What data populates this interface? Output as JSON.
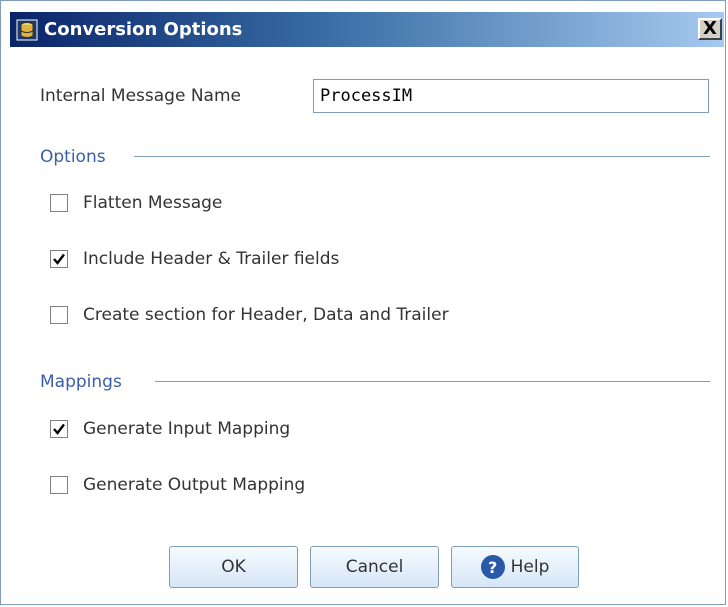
{
  "window": {
    "title": "Conversion Options",
    "close_label": "X"
  },
  "form": {
    "internal_message_label": "Internal Message Name",
    "internal_message_value": "ProcessIM"
  },
  "options": {
    "header": "Options",
    "items": [
      {
        "label": "Flatten Message",
        "checked": false
      },
      {
        "label": "Include Header & Trailer fields",
        "checked": true
      },
      {
        "label": "Create section for Header, Data and Trailer",
        "checked": false
      }
    ]
  },
  "mappings": {
    "header": "Mappings",
    "items": [
      {
        "label": "Generate Input Mapping",
        "checked": true
      },
      {
        "label": "Generate Output Mapping",
        "checked": false
      }
    ]
  },
  "buttons": {
    "ok": "OK",
    "cancel": "Cancel",
    "help": "Help"
  },
  "colors": {
    "accent": "#3a5ea8",
    "titlebar_start": "#0a246a",
    "border": "#7f9db9"
  },
  "icons": {
    "app": "database-icon",
    "help": "question-mark-icon",
    "check": "checkmark-icon"
  }
}
